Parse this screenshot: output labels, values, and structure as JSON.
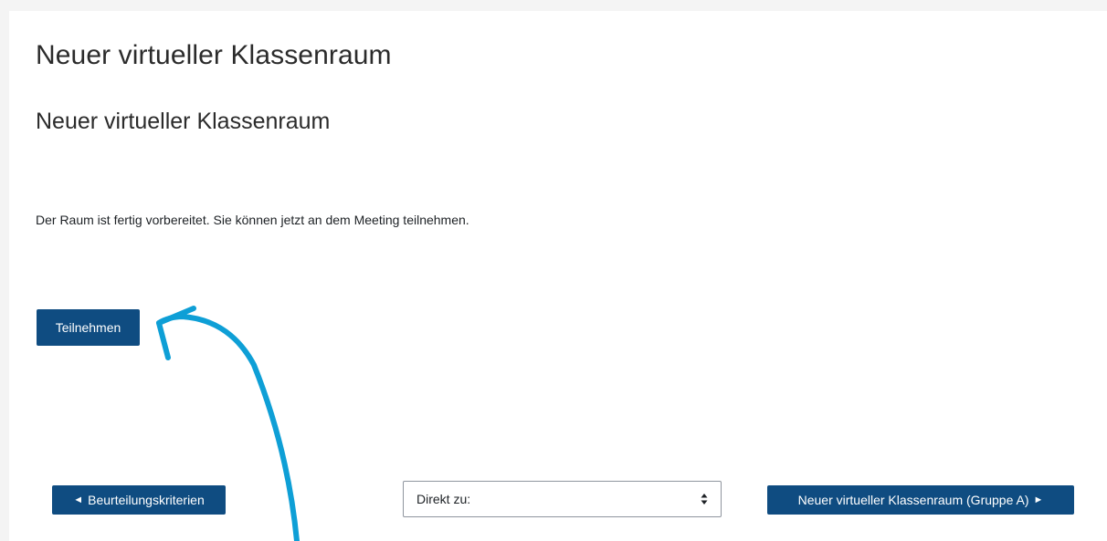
{
  "page": {
    "title": "Neuer virtueller Klassenraum",
    "activity_title": "Neuer virtueller Klassenraum",
    "status_message": "Der Raum ist fertig vorbereitet. Sie können jetzt an dem Meeting teilnehmen."
  },
  "actions": {
    "join_label": "Teilnehmen"
  },
  "navigation": {
    "prev_label": "Beurteilungskriterien",
    "prev_arrow": "◄",
    "jump_select_value": "Direkt zu:",
    "next_label": "Neuer virtueller Klassenraum (Gruppe A)",
    "next_arrow": "►"
  },
  "colors": {
    "button_primary": "#0f4c81",
    "annotation_stroke": "#0e9fd6"
  }
}
